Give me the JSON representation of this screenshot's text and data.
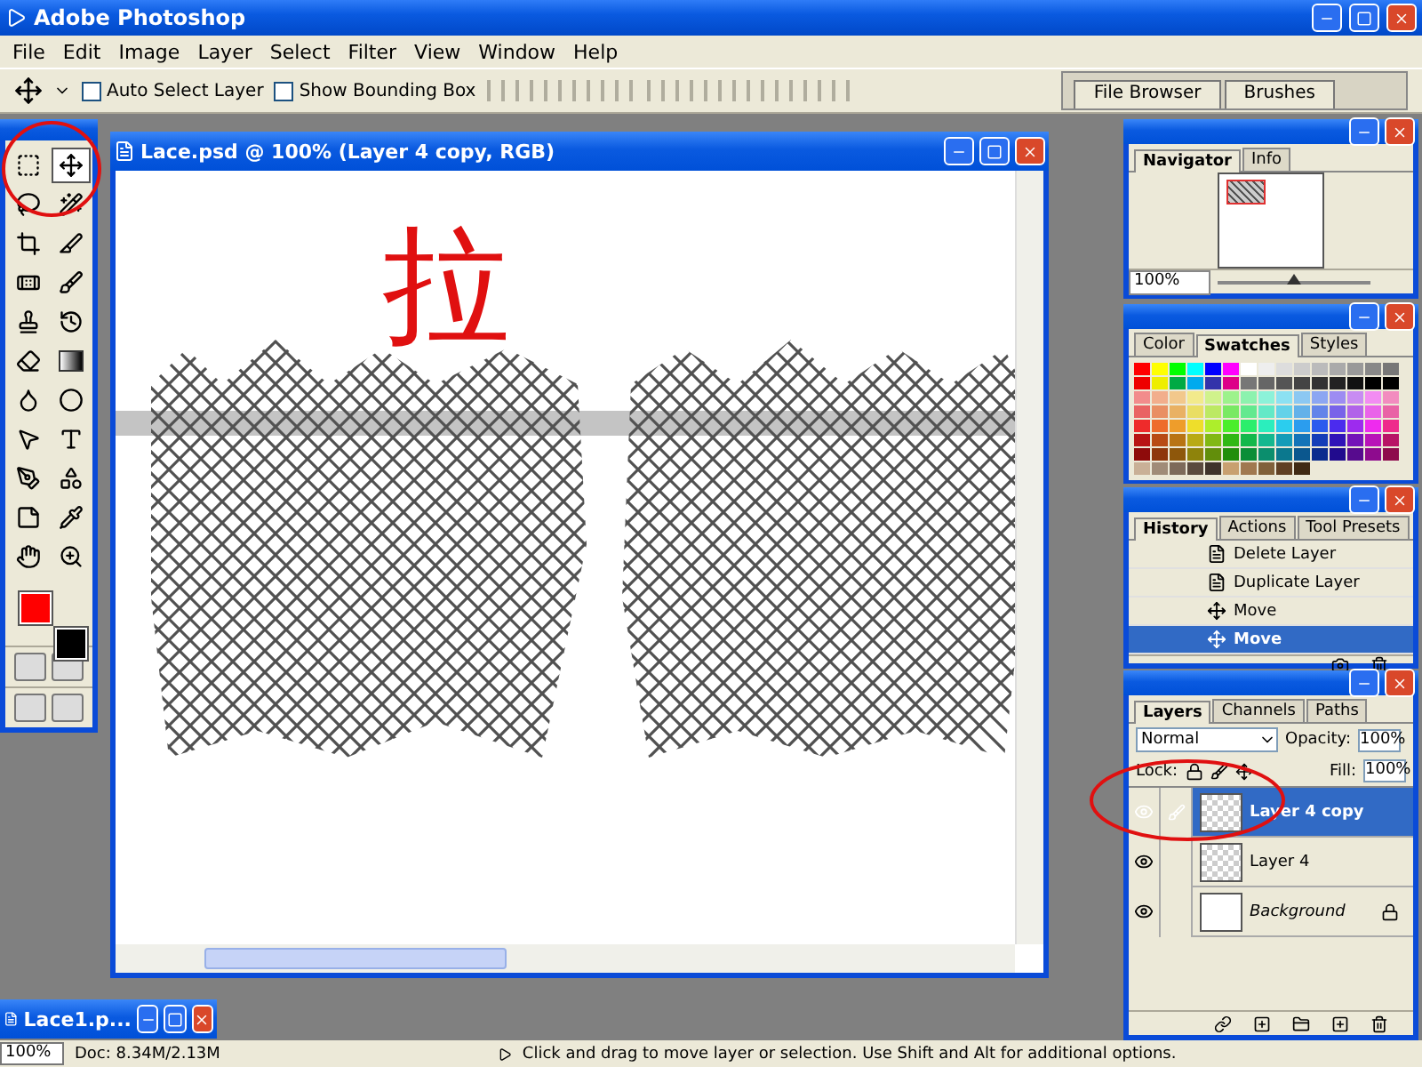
{
  "app": {
    "title": "Adobe Photoshop"
  },
  "menu": [
    "File",
    "Edit",
    "Image",
    "Layer",
    "Select",
    "Filter",
    "View",
    "Window",
    "Help"
  ],
  "options_bar": {
    "checkboxes": [
      {
        "label": "Auto Select Layer",
        "checked": false
      },
      {
        "label": "Show Bounding Box",
        "checked": false
      }
    ]
  },
  "palette_well": [
    "File Browser",
    "Brushes"
  ],
  "toolbox": {
    "tools": [
      {
        "kind": "marquee",
        "selected": false
      },
      {
        "kind": "move",
        "selected": true
      },
      {
        "kind": "lasso",
        "selected": false
      },
      {
        "kind": "wand",
        "selected": false
      },
      {
        "kind": "crop",
        "selected": false
      },
      {
        "kind": "slice",
        "selected": false
      },
      {
        "kind": "heal",
        "selected": false
      },
      {
        "kind": "brush",
        "selected": false
      },
      {
        "kind": "stamp",
        "selected": false
      },
      {
        "kind": "history",
        "selected": false
      },
      {
        "kind": "eraser",
        "selected": false
      },
      {
        "kind": "gradient",
        "selected": false
      },
      {
        "kind": "blur",
        "selected": false
      },
      {
        "kind": "dodge",
        "selected": false
      },
      {
        "kind": "pointer",
        "selected": false
      },
      {
        "kind": "type",
        "selected": false
      },
      {
        "kind": "pen",
        "selected": false
      },
      {
        "kind": "shape",
        "selected": false
      },
      {
        "kind": "notes",
        "selected": false
      },
      {
        "kind": "eyedropper",
        "selected": false
      },
      {
        "kind": "hand",
        "selected": false
      },
      {
        "kind": "zoom",
        "selected": false
      }
    ]
  },
  "document": {
    "title": "Lace.psd @ 100% (Layer 4 copy, RGB)",
    "annotation": "拉"
  },
  "minimized_document": {
    "title": "Lace1.p..."
  },
  "navigator": {
    "tabs": [
      {
        "label": "Navigator",
        "selected": true
      },
      {
        "label": "Info",
        "selected": false
      }
    ],
    "zoom": "100%",
    "level": 0.5
  },
  "swatches": {
    "tabs": [
      {
        "label": "Color",
        "selected": false
      },
      {
        "label": "Swatches",
        "selected": true
      },
      {
        "label": "Styles",
        "selected": false
      }
    ]
  },
  "history": {
    "tabs": [
      {
        "label": "History",
        "selected": true
      },
      {
        "label": "Actions",
        "selected": false
      },
      {
        "label": "Tool Presets",
        "selected": false
      }
    ],
    "items": [
      {
        "label": "Delete Layer",
        "kind": "layer",
        "selected": false
      },
      {
        "label": "Duplicate Layer",
        "kind": "layer",
        "selected": false
      },
      {
        "label": "Move",
        "kind": "move",
        "selected": false
      },
      {
        "label": "Move",
        "kind": "move",
        "selected": true
      }
    ]
  },
  "layers": {
    "tabs": [
      {
        "label": "Layers",
        "selected": true
      },
      {
        "label": "Channels",
        "selected": false
      },
      {
        "label": "Paths",
        "selected": false
      }
    ],
    "blend_mode": "Normal",
    "opacity_label": "Opacity:",
    "opacity": "100%",
    "lock_label": "Lock:",
    "fill_label": "Fill:",
    "fill": "100%",
    "items": [
      {
        "name": "Layer 4 copy",
        "kind": "layer",
        "visible": true,
        "selected": true,
        "locked": false
      },
      {
        "name": "Layer 4",
        "kind": "layer",
        "visible": true,
        "selected": false,
        "locked": false
      },
      {
        "name": "Background",
        "kind": "background",
        "visible": true,
        "selected": false,
        "locked": true
      }
    ]
  },
  "status_bar": {
    "zoom": "100%",
    "doc": "Doc: 8.34M/2.13M",
    "hint": "Click and drag to move layer or selection. Use Shift and Alt for additional options."
  }
}
